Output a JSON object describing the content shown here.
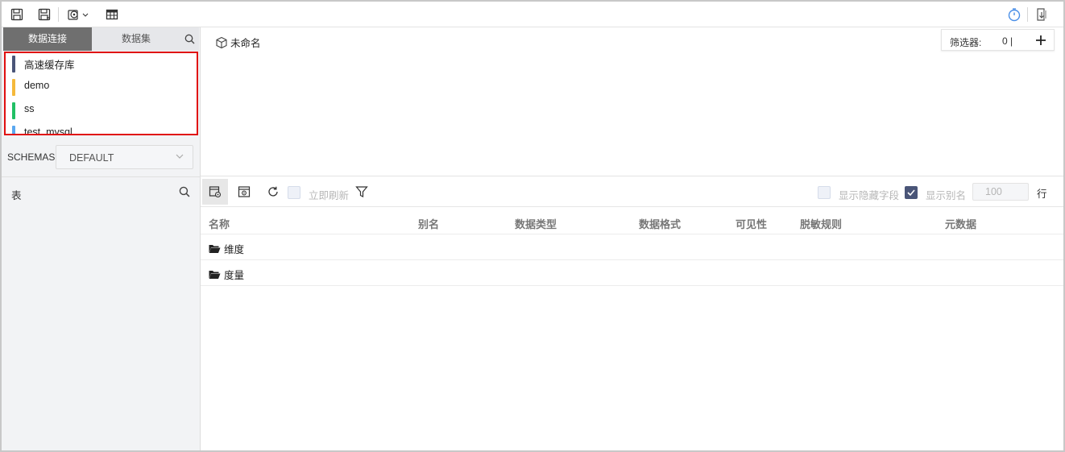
{
  "toolbar": {
    "icons": [
      "save-icon",
      "save-as-icon",
      "settings-dropdown-icon",
      "table-icon",
      "timer-icon",
      "export-icon"
    ],
    "accent_color": "#4a8fe7"
  },
  "left_panel": {
    "tabs": [
      {
        "label": "数据连接",
        "active": true
      },
      {
        "label": "数据集",
        "active": false
      }
    ],
    "connections": [
      {
        "label": "高速缓存库",
        "color": "#4a5578"
      },
      {
        "label": "demo",
        "color": "#f5b93b"
      },
      {
        "label": "ss",
        "color": "#21c065"
      },
      {
        "label": "test_mysql",
        "color": "#5aa8f0"
      }
    ],
    "schema": {
      "label": "SCHEMAS",
      "selected": "DEFAULT"
    },
    "table_section": {
      "label": "表"
    }
  },
  "canvas": {
    "dataset_name": "未命名",
    "filter": {
      "label": "筛选器:",
      "count": "0 |"
    }
  },
  "field_toolbar": {
    "refresh_now_label": "立即刷新",
    "show_hidden_fields_label": "显示隐藏字段",
    "show_hidden_fields_checked": false,
    "show_alias_label": "显示别名",
    "show_alias_checked": true,
    "row_count": "100",
    "row_unit": "行"
  },
  "grid": {
    "columns": [
      "名称",
      "别名",
      "数据类型",
      "数据格式",
      "可见性",
      "脱敏规则",
      "元数据"
    ],
    "rows": [
      {
        "label": "维度"
      },
      {
        "label": "度量"
      }
    ]
  }
}
